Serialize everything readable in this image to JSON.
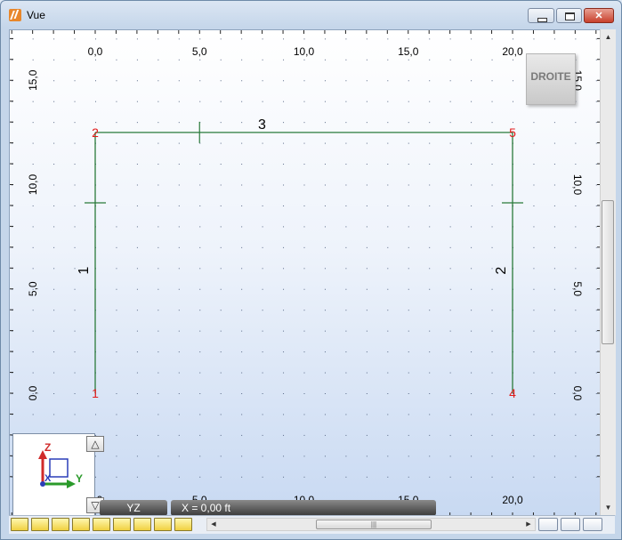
{
  "window": {
    "title": "Vue",
    "minimize_icon": "minimize-icon",
    "maximize_icon": "maximize-icon",
    "close_icon": "close-icon",
    "close_glyph": "✕"
  },
  "view": {
    "cube_label": "DROITE",
    "plane_label": "YZ",
    "coordinate_label": "X = 0,00 ft",
    "axes": {
      "horizontal": "Y",
      "vertical": "Z",
      "depth": "X"
    },
    "x_ticks": [
      "0,0",
      "5,0",
      "10,0",
      "15,0",
      "20,0"
    ],
    "y_ticks": [
      "0,0",
      "5,0",
      "10,0",
      "15,0"
    ]
  },
  "model": {
    "nodes": [
      {
        "id": "1",
        "y": 0,
        "z": 0
      },
      {
        "id": "2",
        "y": 0,
        "z": 12.5
      },
      {
        "id": "5",
        "y": 20,
        "z": 12.5
      },
      {
        "id": "4",
        "y": 20,
        "z": 0
      }
    ],
    "members": [
      {
        "id": "1",
        "from": "1",
        "to": "2"
      },
      {
        "id": "3",
        "from": "2",
        "to": "5"
      },
      {
        "id": "2",
        "from": "4",
        "to": "5"
      }
    ],
    "colors": {
      "member": "#2a7a3a",
      "node_label": "#e31a1a",
      "member_label": "#000000"
    }
  },
  "toolbar": {
    "left_buttons": [
      "node-tool",
      "member-tool",
      "support-tool",
      "load-tool",
      "release-tool",
      "section-tool",
      "plate-tool",
      "label-tool",
      "number-tool"
    ],
    "right_buttons": [
      "hide-tool",
      "link-tool",
      "render-tool"
    ]
  }
}
